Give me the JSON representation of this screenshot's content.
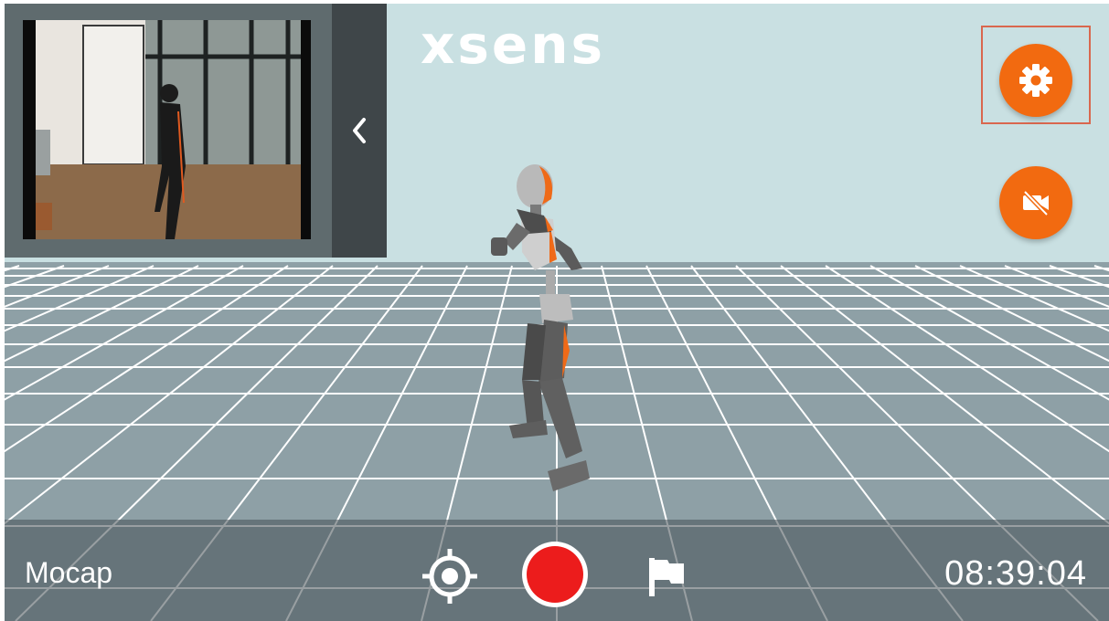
{
  "header": {
    "logo_text": "xsens"
  },
  "preview": {
    "collapse_icon": "chevron-left-icon"
  },
  "actions": {
    "settings_icon": "gear-icon",
    "camera_off_icon": "video-off-icon",
    "accent_color": "#f26a10"
  },
  "bottom_bar": {
    "mode_label": "Mocap",
    "timecode": "08:39:04",
    "target_icon": "crosshair-icon",
    "record_icon": "record-icon",
    "marker_icon": "flag-icon",
    "record_color": "#ec1c1c"
  }
}
